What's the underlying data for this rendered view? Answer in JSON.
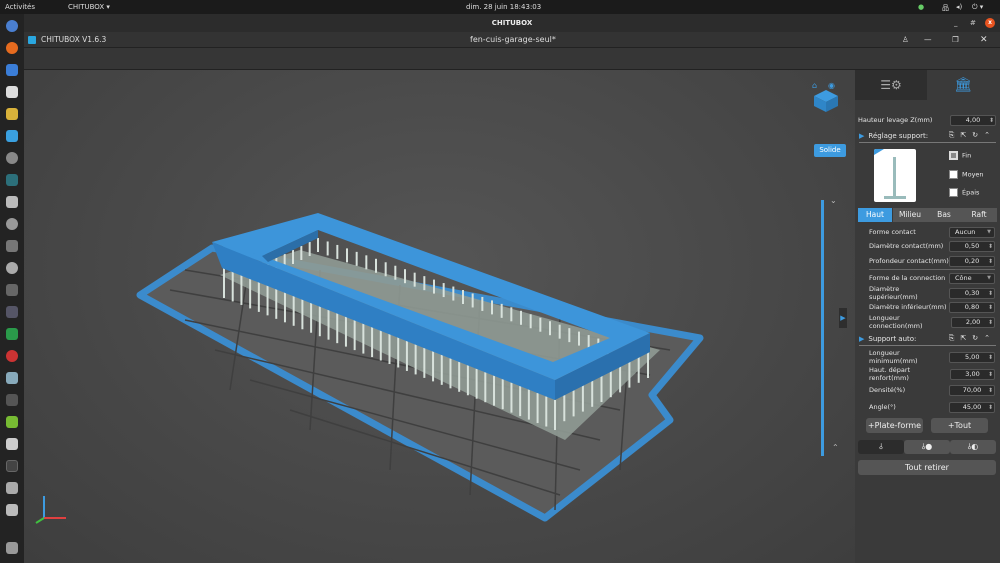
{
  "system": {
    "activities": "Activités",
    "app_menu": "CHITUBOX ▾",
    "clock": "dim. 28 juin  18:43:03"
  },
  "window": {
    "title": "CHITUBOX",
    "app_name": "CHITUBOX V1.6.3",
    "file_name": "fen-cuis-garage-seul*"
  },
  "viewport": {
    "render_mode": "Solide"
  },
  "panel": {
    "lift_height_label": "Hauteur levage Z(mm)",
    "lift_height": "4,00",
    "support_settings_label": "Réglage support:",
    "presets": [
      {
        "label": "Fin",
        "checked": true
      },
      {
        "label": "Moyen",
        "checked": false
      },
      {
        "label": "Épais",
        "checked": false
      }
    ],
    "tabs": [
      "Haut",
      "Milieu",
      "Bas",
      "Raft"
    ],
    "active_tab": "Haut",
    "fields": [
      {
        "label": "Forme contact",
        "value": "Aucun",
        "type": "combo"
      },
      {
        "label": "Diamètre contact(mm)",
        "value": "0,50"
      },
      {
        "label": "Profondeur contact(mm)",
        "value": "0,20"
      },
      {
        "label": "Forme de la connection",
        "value": "Cône",
        "type": "combo"
      },
      {
        "label": "Diamètre supérieur(mm)",
        "value": "0,30"
      },
      {
        "label": "Diamètre inférieur(mm)",
        "value": "0,80"
      },
      {
        "label": "Longueur connection(mm)",
        "value": "2,00"
      }
    ],
    "auto_support_label": "Support auto:",
    "auto_fields": [
      {
        "label": "Longueur minimum(mm)",
        "value": "5,00"
      },
      {
        "label": "Haut. départ renfort(mm)",
        "value": "3,00"
      },
      {
        "label": "Densité(%)",
        "value": "70,00"
      },
      {
        "label": "Angle(°)",
        "value": "45,00"
      }
    ],
    "platform_button": "+Plate-forme",
    "all_button": "+Tout",
    "remove_all_button": "Tout retirer"
  },
  "colors": {
    "accent": "#3d9be0",
    "model": "#3a8fd6",
    "close": "#e95420"
  }
}
